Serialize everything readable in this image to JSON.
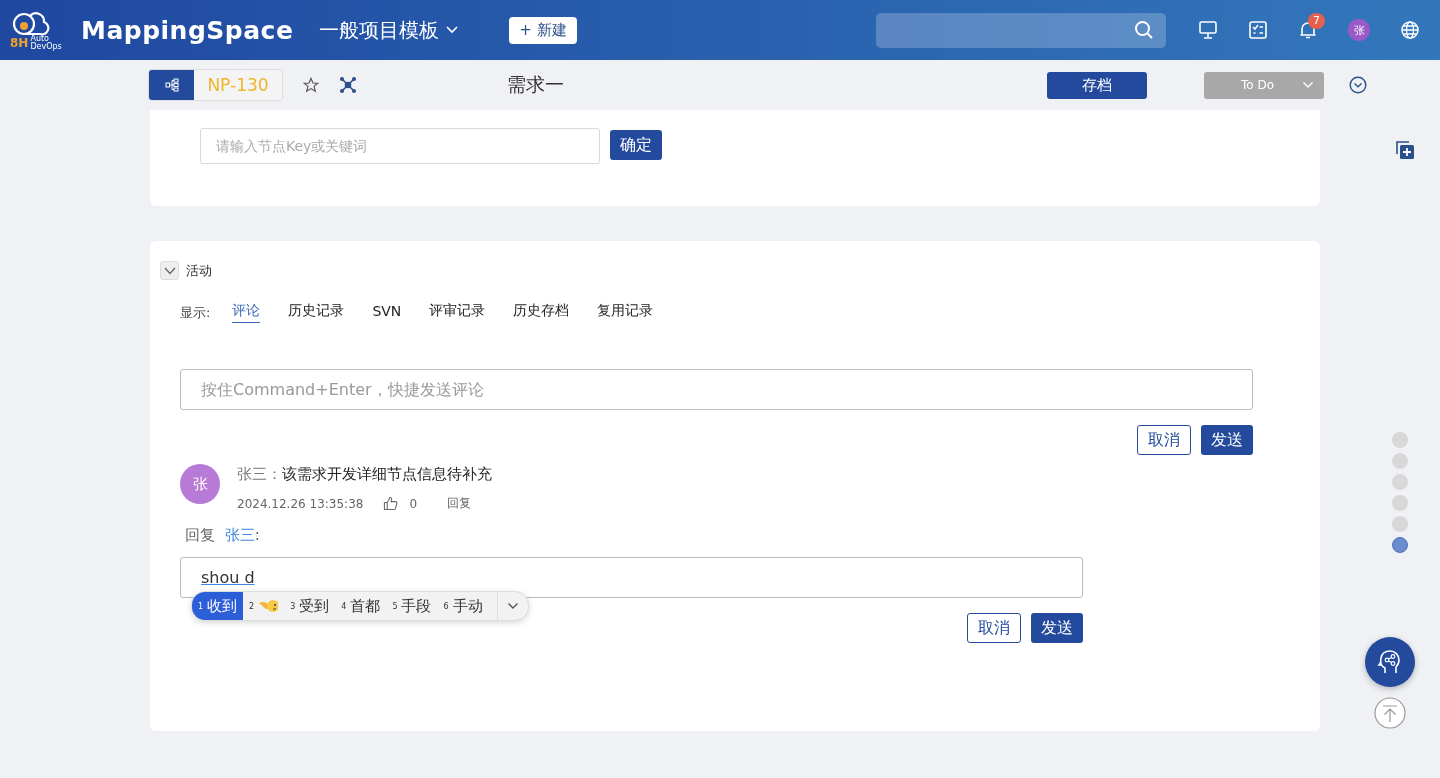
{
  "header": {
    "logo_big": "8H",
    "logo_small_1": "Auto",
    "logo_small_2": "DevOps",
    "brand": "MappingSpace",
    "project": "一般项目模板",
    "new_button": "+ 新建",
    "notification_count": "7",
    "avatar": "张"
  },
  "subbar": {
    "key": "NP-130",
    "title": "需求一",
    "archive_button": "存档",
    "status": "To Do"
  },
  "search_card": {
    "placeholder": "请输入节点Key或关键词",
    "confirm_button": "确定"
  },
  "activity": {
    "title": "活动",
    "expanded": true,
    "show_label": "显示:",
    "tabs": [
      {
        "label": "评论",
        "selected": true
      },
      {
        "label": "历史记录",
        "selected": false
      },
      {
        "label": "SVN",
        "selected": false
      },
      {
        "label": "评审记录",
        "selected": false
      },
      {
        "label": "历史存档",
        "selected": false
      },
      {
        "label": "复用记录",
        "selected": false
      }
    ],
    "comment_field": {
      "placeholder": "按住Command+Enter，快捷发送评论"
    },
    "cancel_button": "取消",
    "send_button": "发送",
    "comment": {
      "avatar": "张",
      "author": "张三：",
      "text": "该需求开发详细节点信息待补充",
      "time": "2024.12.26 13:35:38",
      "likes": "0",
      "reply_link": "回复"
    },
    "reply_label": "回复",
    "reply_to": "张三",
    "reply_colon": ":",
    "reply_field": {
      "value": "shou d"
    },
    "reply_cancel": "取消",
    "reply_send": "发送",
    "ime_candidates": [
      {
        "kind": "text",
        "number": "1",
        "text": "收到",
        "selected": true
      },
      {
        "kind": "emoji",
        "number": "2",
        "selected": false
      },
      {
        "kind": "text",
        "number": "3",
        "text": "受到",
        "selected": false
      },
      {
        "kind": "text",
        "number": "4",
        "text": "首都",
        "selected": false
      },
      {
        "kind": "text",
        "number": "5",
        "text": "手段",
        "selected": false
      },
      {
        "kind": "text",
        "number": "6",
        "text": "手动",
        "selected": false
      }
    ]
  },
  "page_dots": [
    {
      "selected": false
    },
    {
      "selected": false
    },
    {
      "selected": false
    },
    {
      "selected": false
    },
    {
      "selected": false
    },
    {
      "selected": true
    }
  ]
}
